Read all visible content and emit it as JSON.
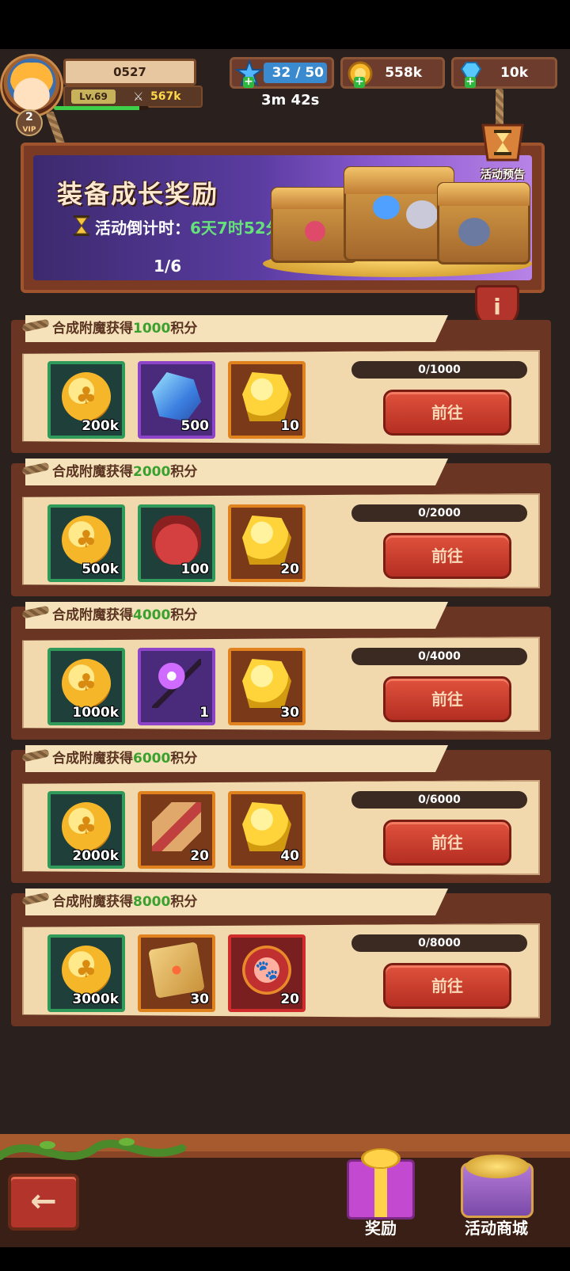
{
  "player": {
    "id": "0527",
    "level": "Lv.69",
    "power": "567k",
    "vip": "2",
    "vip_label": "VIP",
    "xp_fraction": 0.9
  },
  "resources": {
    "energy_current": "32",
    "energy_sep": "/",
    "energy_max": "50",
    "energy_timer": "3m 42s",
    "gold": "558k",
    "diamonds": "10k"
  },
  "banner": {
    "title": "装备成长奖励",
    "countdown_label": "活动倒计时：",
    "countdown_value": "6天7时52分",
    "page_indicator": "1/6",
    "preview_label": "活动预告",
    "info_icon": "i"
  },
  "tasks": [
    {
      "title_prefix": "合成附魔获得",
      "points": "1000",
      "title_suffix": "积分",
      "progress_text": "0/1000",
      "progress_fraction": 0,
      "button": "前往",
      "rewards": [
        {
          "icon": "gold-coin-icon",
          "count": "200k",
          "rarity": "green"
        },
        {
          "icon": "blue-crystal-icon",
          "count": "500",
          "rarity": "purple"
        },
        {
          "icon": "gold-ore-icon",
          "count": "10",
          "rarity": "orange"
        }
      ]
    },
    {
      "title_prefix": "合成附魔获得",
      "points": "2000",
      "title_suffix": "积分",
      "progress_text": "0/2000",
      "progress_fraction": 0,
      "button": "前往",
      "rewards": [
        {
          "icon": "gold-coin-icon",
          "count": "500k",
          "rarity": "green"
        },
        {
          "icon": "red-bag-icon",
          "count": "100",
          "rarity": "green"
        },
        {
          "icon": "gold-ore-icon",
          "count": "20",
          "rarity": "orange"
        }
      ]
    },
    {
      "title_prefix": "合成附魔获得",
      "points": "4000",
      "title_suffix": "积分",
      "progress_text": "0/4000",
      "progress_fraction": 0,
      "button": "前往",
      "rewards": [
        {
          "icon": "gold-coin-icon",
          "count": "1000k",
          "rarity": "green"
        },
        {
          "icon": "magic-staff-icon",
          "count": "1",
          "rarity": "purple"
        },
        {
          "icon": "gold-ore-icon",
          "count": "30",
          "rarity": "orange"
        }
      ]
    },
    {
      "title_prefix": "合成附魔获得",
      "points": "6000",
      "title_suffix": "积分",
      "progress_text": "0/6000",
      "progress_fraction": 0,
      "button": "前往",
      "rewards": [
        {
          "icon": "gold-coin-icon",
          "count": "2000k",
          "rarity": "green"
        },
        {
          "icon": "rose-scroll-icon",
          "count": "20",
          "rarity": "orange"
        },
        {
          "icon": "gold-ore-icon",
          "count": "40",
          "rarity": "orange"
        }
      ]
    },
    {
      "title_prefix": "合成附魔获得",
      "points": "8000",
      "title_suffix": "积分",
      "progress_text": "0/8000",
      "progress_fraction": 0,
      "button": "前往",
      "rewards": [
        {
          "icon": "gold-coin-icon",
          "count": "3000k",
          "rarity": "green"
        },
        {
          "icon": "gem-box-icon",
          "count": "30",
          "rarity": "orange"
        },
        {
          "icon": "paw-token-icon",
          "count": "20",
          "rarity": "red"
        }
      ]
    }
  ],
  "bottom_nav": {
    "back_icon": "←",
    "rewards_label": "奖励",
    "shop_label": "活动商城"
  },
  "colors": {
    "highlight_green": "#3aa02e",
    "countdown_green": "#66e07a",
    "button_red": "#b42e22"
  }
}
